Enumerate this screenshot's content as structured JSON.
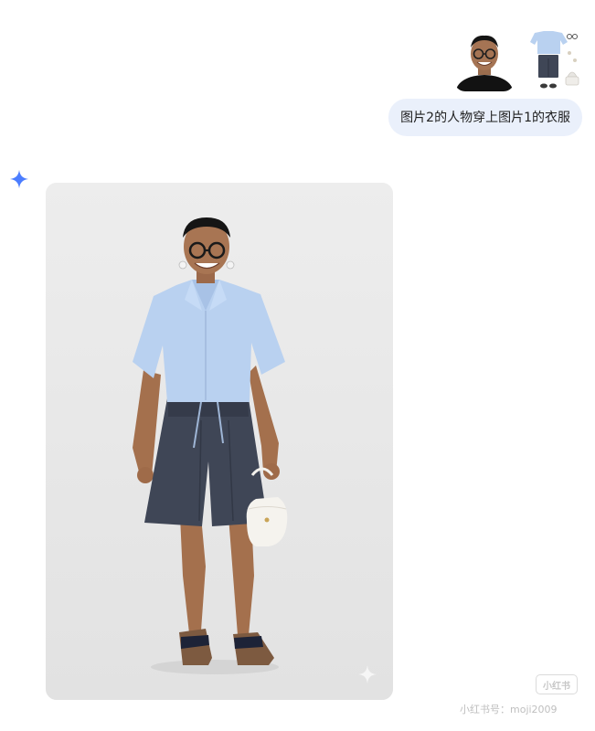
{
  "conversation": {
    "user_message": {
      "text": "图片2的人物穿上图片1的衣服",
      "attachments": [
        {
          "kind": "portrait",
          "label": ""
        },
        {
          "kind": "outfit",
          "label": ""
        }
      ]
    }
  },
  "assistant_reply": {
    "image_kind": "generated-outfit-photo"
  },
  "watermark": {
    "badge_text": "小红书",
    "text": "小红书号：moji2009"
  },
  "colors": {
    "bubble_bg": "#eaf0fb",
    "sparkle": "#4b7dff",
    "image_bg": "#ececec",
    "shirt": "#b9d1f0",
    "shorts": "#3f4656"
  }
}
